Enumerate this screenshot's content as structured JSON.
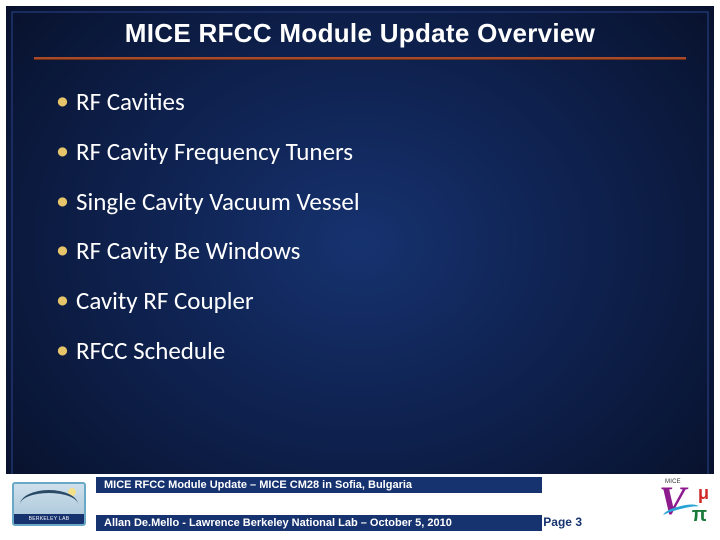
{
  "title": "MICE RFCC Module Update Overview",
  "bullets": [
    "RF Cavities",
    "RF Cavity Frequency Tuners",
    "Single Cavity Vacuum Vessel",
    "RF Cavity Be Windows",
    "Cavity RF Coupler",
    "RFCC Schedule"
  ],
  "footer": {
    "line1": "MICE RFCC Module Update – MICE CM28 in Sofia, Bulgaria",
    "line2": "Allan De.Mello - Lawrence Berkeley National Lab – October 5, 2010",
    "page_label": "Page 3",
    "left_logo_caption": "BERKELEY LAB"
  },
  "colors": {
    "bg_center": "#16326f",
    "bg_edge": "#070f26",
    "accent_rule": "#a84a2a",
    "bullet_glyph": "#e6c46a",
    "footer_bar": "#16326f"
  }
}
